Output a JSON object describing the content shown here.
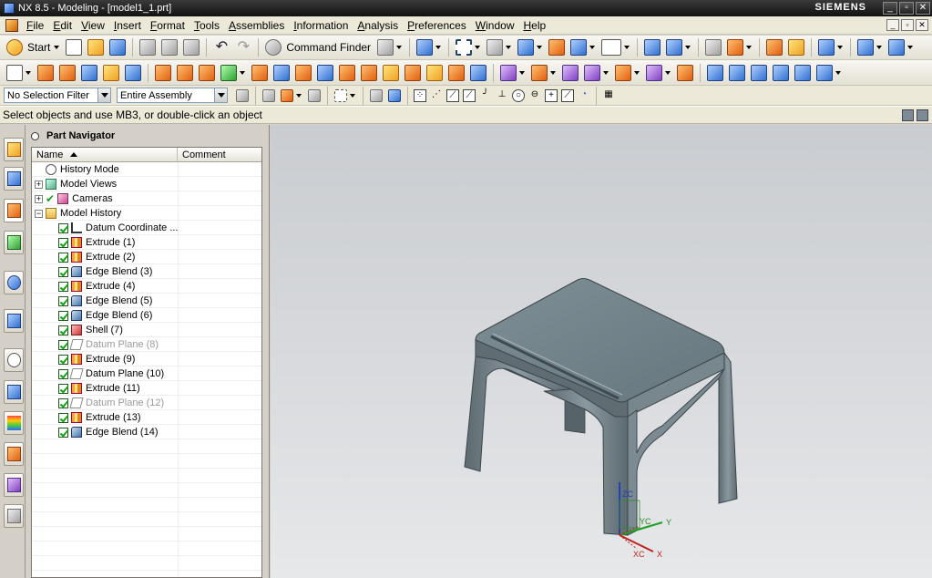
{
  "window": {
    "title": "NX 8.5 - Modeling - [model1_1.prt]",
    "brand": "SIEMENS",
    "buttons": [
      "_",
      "▫",
      "✕"
    ]
  },
  "menubar": {
    "items": [
      {
        "label": "File",
        "u": "F",
        "rest": "ile"
      },
      {
        "label": "Edit",
        "u": "E",
        "rest": "dit"
      },
      {
        "label": "View",
        "u": "V",
        "rest": "iew"
      },
      {
        "label": "Insert",
        "u": "I",
        "rest": "nsert"
      },
      {
        "label": "Format",
        "u": "F",
        "rest": "ormat"
      },
      {
        "label": "Tools",
        "u": "T",
        "rest": "ools"
      },
      {
        "label": "Assemblies",
        "u": "A",
        "rest": "ssemblies"
      },
      {
        "label": "Information",
        "u": "I",
        "rest": "nformation"
      },
      {
        "label": "Analysis",
        "u": "A",
        "rest": "nalysis"
      },
      {
        "label": "Preferences",
        "u": "P",
        "rest": "references"
      },
      {
        "label": "Window",
        "u": "W",
        "rest": "indow"
      },
      {
        "label": "Help",
        "u": "H",
        "rest": "elp"
      }
    ],
    "mdi_buttons": [
      "_",
      "▫",
      "✕"
    ]
  },
  "toolbar1": {
    "start_label": "Start",
    "command_finder_label": "Command Finder"
  },
  "toolbar3": {
    "selection_filter": "No Selection Filter",
    "assembly_scope": "Entire Assembly"
  },
  "cue_line": "Select objects and use MB3, or double-click an object",
  "navigator": {
    "title": "Part Navigator",
    "columns": {
      "name": "Name",
      "comment": "Comment"
    },
    "rows": [
      {
        "label": "History Mode",
        "icon": "clock-icon",
        "level": 0,
        "expander": "",
        "check": false,
        "greencheck": false,
        "dim": false
      },
      {
        "label": "Model Views",
        "icon": "model-views-icon",
        "level": 0,
        "expander": "+",
        "check": false,
        "greencheck": false,
        "dim": false
      },
      {
        "label": "Cameras",
        "icon": "camera-icon",
        "level": 0,
        "expander": "+",
        "check": false,
        "greencheck": true,
        "dim": false
      },
      {
        "label": "Model History",
        "icon": "folder-icon",
        "level": 0,
        "expander": "−",
        "check": false,
        "greencheck": false,
        "dim": false
      },
      {
        "label": "Datum Coordinate ...",
        "icon": "datum-csys-icon",
        "level": 1,
        "expander": "",
        "check": true,
        "greencheck": false,
        "dim": false
      },
      {
        "label": "Extrude (1)",
        "icon": "extrude-icon",
        "level": 1,
        "expander": "",
        "check": true,
        "greencheck": false,
        "dim": false
      },
      {
        "label": "Extrude (2)",
        "icon": "extrude-icon",
        "level": 1,
        "expander": "",
        "check": true,
        "greencheck": false,
        "dim": false
      },
      {
        "label": "Edge Blend (3)",
        "icon": "edge-blend-icon",
        "level": 1,
        "expander": "",
        "check": true,
        "greencheck": false,
        "dim": false
      },
      {
        "label": "Extrude (4)",
        "icon": "extrude-icon",
        "level": 1,
        "expander": "",
        "check": true,
        "greencheck": false,
        "dim": false
      },
      {
        "label": "Edge Blend (5)",
        "icon": "edge-blend-icon",
        "level": 1,
        "expander": "",
        "check": true,
        "greencheck": false,
        "dim": false
      },
      {
        "label": "Edge Blend (6)",
        "icon": "edge-blend-icon",
        "level": 1,
        "expander": "",
        "check": true,
        "greencheck": false,
        "dim": false
      },
      {
        "label": "Shell (7)",
        "icon": "shell-icon",
        "level": 1,
        "expander": "",
        "check": true,
        "greencheck": false,
        "dim": false
      },
      {
        "label": "Datum Plane (8)",
        "icon": "datum-plane-icon",
        "level": 1,
        "expander": "",
        "check": true,
        "greencheck": false,
        "dim": true
      },
      {
        "label": "Extrude (9)",
        "icon": "extrude-icon",
        "level": 1,
        "expander": "",
        "check": true,
        "greencheck": false,
        "dim": false
      },
      {
        "label": "Datum Plane (10)",
        "icon": "datum-plane-icon",
        "level": 1,
        "expander": "",
        "check": true,
        "greencheck": false,
        "dim": false
      },
      {
        "label": "Extrude (11)",
        "icon": "extrude-icon",
        "level": 1,
        "expander": "",
        "check": true,
        "greencheck": false,
        "dim": false
      },
      {
        "label": "Datum Plane (12)",
        "icon": "datum-plane-icon",
        "level": 1,
        "expander": "",
        "check": true,
        "greencheck": false,
        "dim": true
      },
      {
        "label": "Extrude (13)",
        "icon": "extrude-icon",
        "level": 1,
        "expander": "",
        "check": true,
        "greencheck": false,
        "dim": false
      },
      {
        "label": "Edge Blend (14)",
        "icon": "edge-blend-icon",
        "level": 1,
        "expander": "",
        "check": true,
        "greencheck": false,
        "dim": false
      }
    ],
    "empty_rows": 10
  },
  "triad": {
    "zc": "ZC",
    "yc": "YC",
    "xc": "XC",
    "y": "Y",
    "x": "X"
  },
  "colors": {
    "part_body": "#6f7f86",
    "axis_x": "#c02020",
    "axis_y": "#20a020",
    "axis_z": "#2040c0"
  }
}
